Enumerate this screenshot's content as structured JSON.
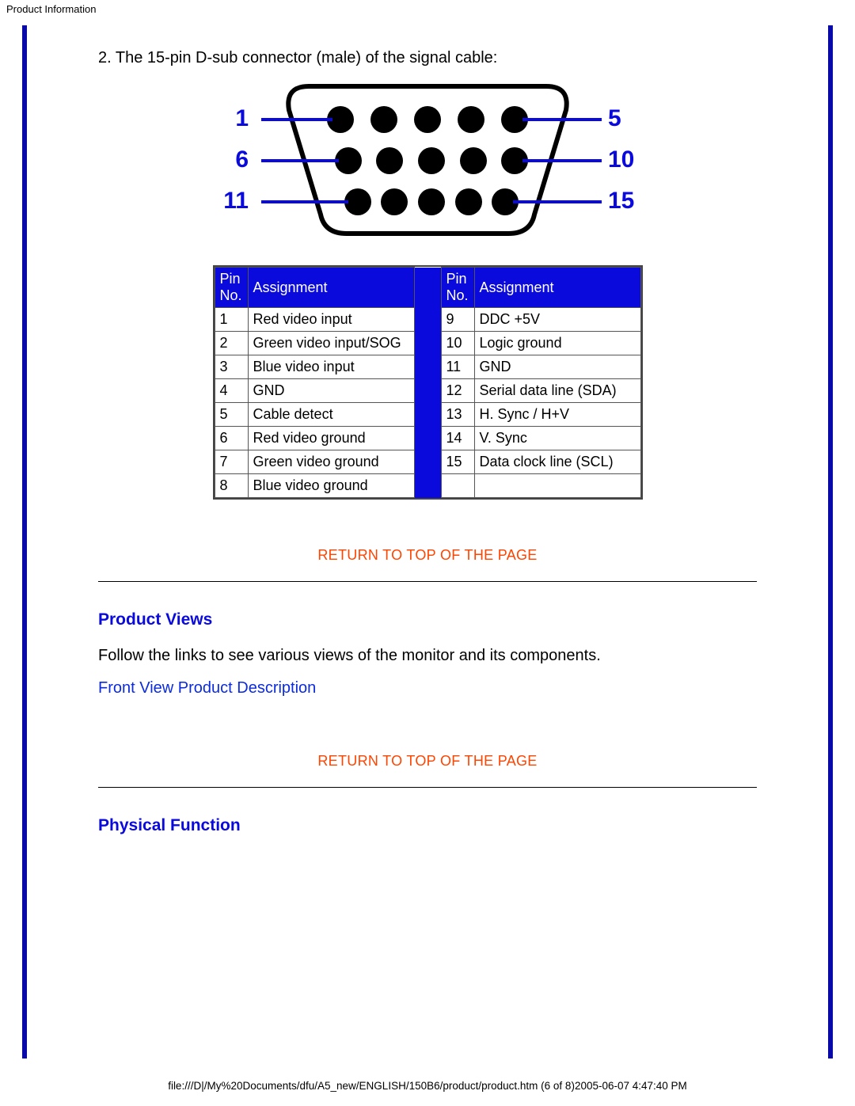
{
  "header": {
    "title": "Product Information"
  },
  "intro": {
    "line2": "2. The 15-pin D-sub connector (male) of the signal cable:"
  },
  "svg_labels": {
    "l1": "1",
    "l6": "6",
    "l11": "11",
    "r5": "5",
    "r10": "10",
    "r15": "15"
  },
  "table": {
    "head": {
      "pin": "Pin No.",
      "assign": "Assignment"
    },
    "left": [
      {
        "pin": "1",
        "assign": "Red video input"
      },
      {
        "pin": "2",
        "assign": "Green video input/SOG"
      },
      {
        "pin": "3",
        "assign": "Blue video input"
      },
      {
        "pin": "4",
        "assign": "GND"
      },
      {
        "pin": "5",
        "assign": "Cable detect"
      },
      {
        "pin": "6",
        "assign": "Red video ground"
      },
      {
        "pin": "7",
        "assign": "Green video ground"
      },
      {
        "pin": "8",
        "assign": "Blue video ground"
      }
    ],
    "right": [
      {
        "pin": "9",
        "assign": "DDC +5V"
      },
      {
        "pin": "10",
        "assign": "Logic ground"
      },
      {
        "pin": "11",
        "assign": "GND"
      },
      {
        "pin": "12",
        "assign": "Serial data line (SDA)"
      },
      {
        "pin": "13",
        "assign": "H. Sync / H+V"
      },
      {
        "pin": "14",
        "assign": "V. Sync"
      },
      {
        "pin": "15",
        "assign": "Data clock line (SCL)"
      },
      {
        "pin": "",
        "assign": ""
      }
    ]
  },
  "links": {
    "returnTop": "RETURN TO TOP OF THE PAGE",
    "productViews": "Product Views",
    "productViewsText": "Follow the links to see various views of the monitor and its components.",
    "frontView": "Front View Product Description",
    "physicalFunction": "Physical Function"
  },
  "footer": {
    "path": "file:///D|/My%20Documents/dfu/A5_new/ENGLISH/150B6/product/product.htm (6 of 8)2005-06-07 4:47:40 PM"
  }
}
